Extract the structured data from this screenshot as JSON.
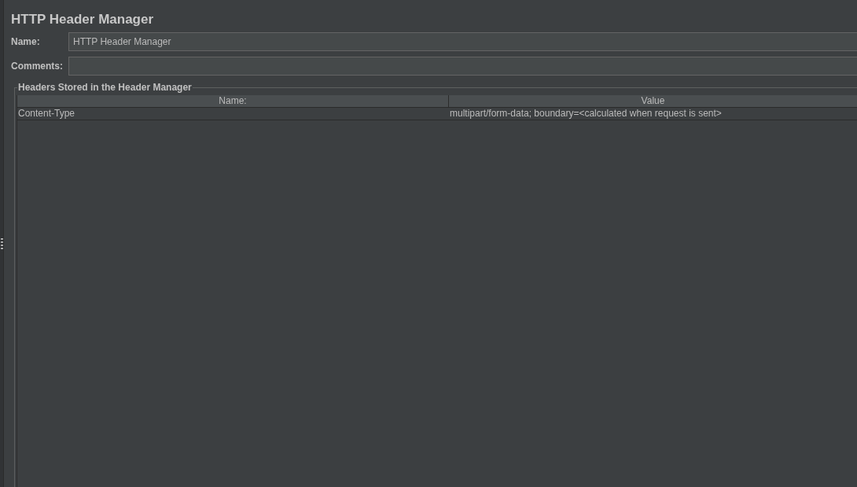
{
  "title": "HTTP Header Manager",
  "fields": [
    {
      "label": "Name:",
      "value": "HTTP Header Manager"
    },
    {
      "label": "Comments:"
    }
  ],
  "headers_group": {
    "title": "Headers Stored in the Header Manager",
    "columns": [
      "Name:",
      "Value"
    ],
    "rows": [
      {
        "name": "Content-Type",
        "value": "multipart/form-data; boundary=<calculated when request is sent>"
      }
    ]
  }
}
